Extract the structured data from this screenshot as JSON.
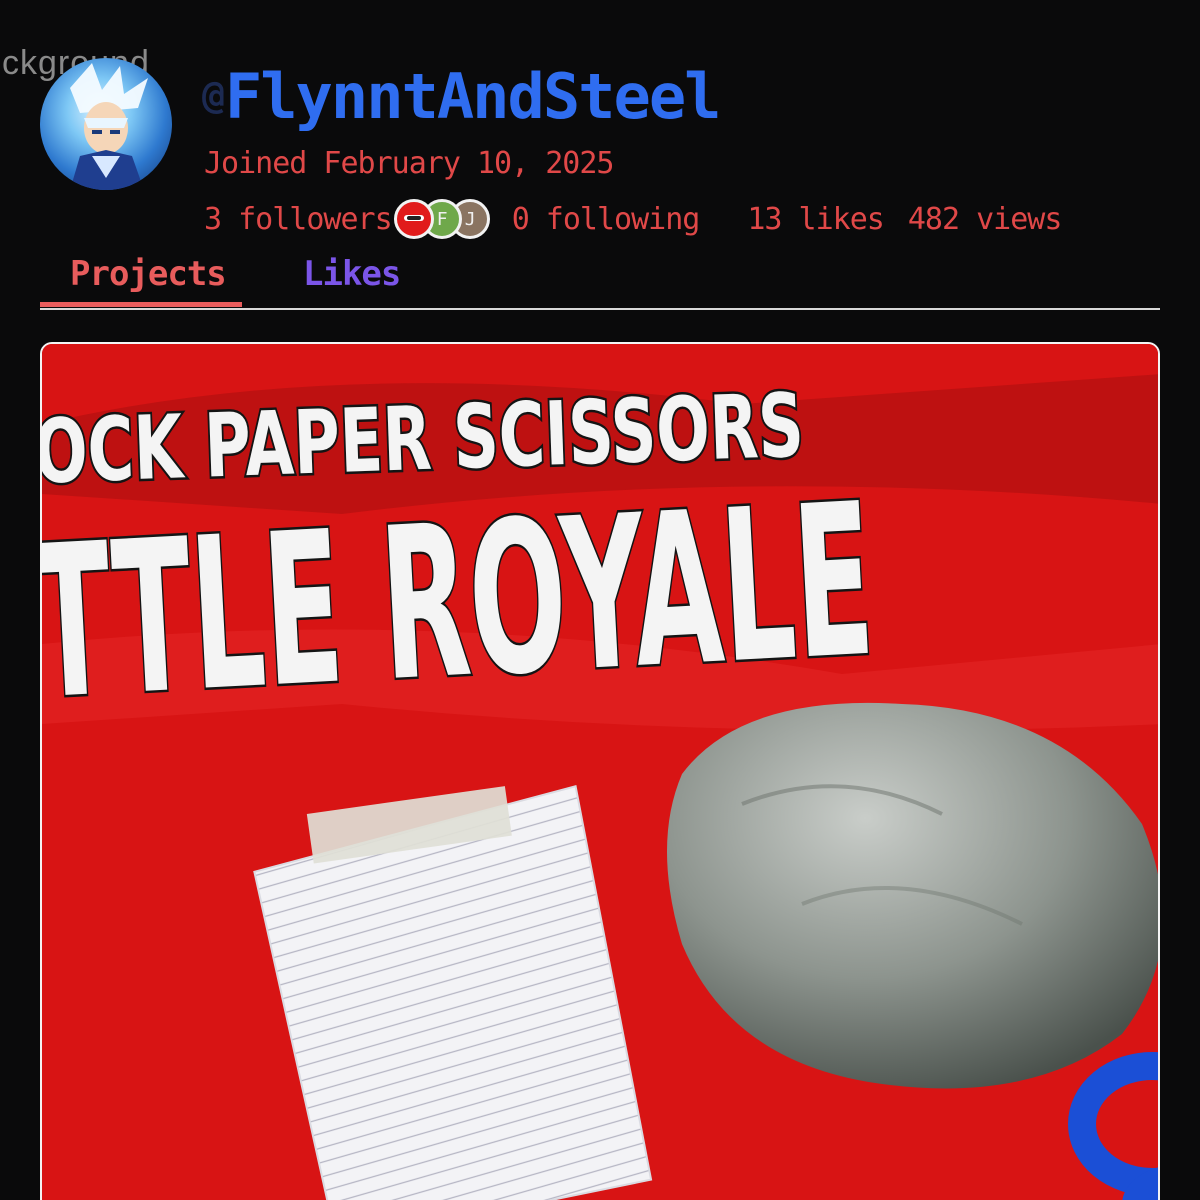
{
  "background_label": "ckground",
  "profile": {
    "avatar_icon": "anime-character-avatar",
    "handle_prefix": "@",
    "username": "FlynntAndSteel",
    "joined": "Joined February 10, 2025",
    "followers": "3 followers",
    "follower_avatars": [
      "",
      "F",
      "J"
    ],
    "following": "0 following",
    "likes": "13 likes",
    "views": "482 views"
  },
  "tabs": [
    {
      "label": "Projects",
      "active": true
    },
    {
      "label": "Likes",
      "active": false
    }
  ],
  "project": {
    "thumbnail_line1": "OCK PAPER SCISSORS",
    "thumbnail_line2": "TTLE ROYALE",
    "thumbnail_icons": [
      "paper-icon",
      "rock-icon",
      "scissors-icon"
    ]
  },
  "colors": {
    "username": "#2f6df0",
    "accent_red": "#e04848",
    "likes_tab": "#7b55e8",
    "thumbnail_bg": "#d81414"
  }
}
